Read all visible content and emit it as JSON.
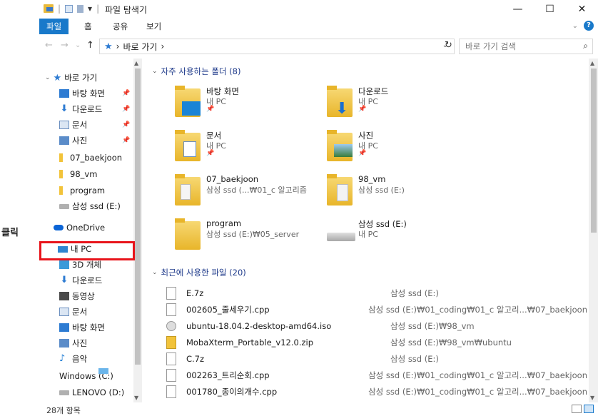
{
  "annotation": {
    "label": "클릭"
  },
  "title_bar": {
    "title": "파일 탐색기",
    "separator": "|",
    "qa_dropdown": "▾"
  },
  "window_controls": {
    "minimize": "—",
    "maximize": "☐",
    "close": "✕"
  },
  "ribbon": {
    "tabs": [
      "파일",
      "홈",
      "공유",
      "보기"
    ],
    "active_tab": "파일",
    "expand_icon": "⌄",
    "help": "?"
  },
  "address_bar": {
    "back": "←",
    "forward": "→",
    "recent": "⌄",
    "up": "↑",
    "path": "바로 가기",
    "separator": "›",
    "dropdown": "⌄",
    "refresh": "↻",
    "search_placeholder": "바로 가기 검색",
    "search_icon": "⌕"
  },
  "nav": {
    "items": [
      {
        "label": "바로 가기",
        "icon": "star-icon",
        "pinned": false
      },
      {
        "label": "바탕 화면",
        "icon": "desktop-icon",
        "pinned": true
      },
      {
        "label": "다운로드",
        "icon": "download-icon",
        "pinned": true
      },
      {
        "label": "문서",
        "icon": "document-icon",
        "pinned": true
      },
      {
        "label": "사진",
        "icon": "picture-icon",
        "pinned": true
      },
      {
        "label": "07_baekjoon",
        "icon": "folder-icon",
        "pinned": false
      },
      {
        "label": "98_vm",
        "icon": "folder-icon",
        "pinned": false
      },
      {
        "label": "program",
        "icon": "folder-icon",
        "pinned": false
      },
      {
        "label": "삼성 ssd (E:)",
        "icon": "drive-icon",
        "pinned": false
      },
      {
        "label": "OneDrive",
        "icon": "cloud-icon",
        "pinned": false
      },
      {
        "label": "내 PC",
        "icon": "pc-icon",
        "pinned": false
      },
      {
        "label": "3D 개체",
        "icon": "cube-icon",
        "pinned": false
      },
      {
        "label": "다운로드",
        "icon": "download-icon",
        "pinned": false
      },
      {
        "label": "동영상",
        "icon": "video-icon",
        "pinned": false
      },
      {
        "label": "문서",
        "icon": "document-icon",
        "pinned": false
      },
      {
        "label": "바탕 화면",
        "icon": "desktop-icon",
        "pinned": false
      },
      {
        "label": "사진",
        "icon": "picture-icon",
        "pinned": false
      },
      {
        "label": "음악",
        "icon": "music-icon",
        "pinned": false
      },
      {
        "label": "Windows (C:)",
        "icon": "windows-drive-icon",
        "pinned": false
      },
      {
        "label": "LENOVO (D:)",
        "icon": "drive-icon",
        "pinned": false
      }
    ],
    "pin_glyph": "📌",
    "expand_glyph": "⌄"
  },
  "frequent": {
    "header": "자주 사용하는 폴더 (8)",
    "items": [
      {
        "name": "바탕 화면",
        "location": "내 PC",
        "pinned": true
      },
      {
        "name": "다운로드",
        "location": "내 PC",
        "pinned": true
      },
      {
        "name": "문서",
        "location": "내 PC",
        "pinned": true
      },
      {
        "name": "사진",
        "location": "내 PC",
        "pinned": true
      },
      {
        "name": "07_baekjoon",
        "location": "삼성 ssd (...₩01_c 알고리즘",
        "pinned": false
      },
      {
        "name": "98_vm",
        "location": "삼성 ssd (E:)",
        "pinned": false
      },
      {
        "name": "program",
        "location": "삼성 ssd (E:)₩05_server",
        "pinned": false
      },
      {
        "name": "삼성 ssd (E:)",
        "location": "내 PC",
        "pinned": false
      }
    ]
  },
  "recent": {
    "header": "최근에 사용한 파일 (20)",
    "files": [
      {
        "name": "E.7z",
        "location": "삼성 ssd (E:)",
        "type": "file"
      },
      {
        "name": "002605_줄세우기.cpp",
        "location": "삼성 ssd (E:)₩01_coding₩01_c 알고리...₩07_baekjoon",
        "type": "file"
      },
      {
        "name": "ubuntu-18.04.2-desktop-amd64.iso",
        "location": "삼성 ssd (E:)₩98_vm",
        "type": "iso"
      },
      {
        "name": "MobaXterm_Portable_v12.0.zip",
        "location": "삼성 ssd (E:)₩98_vm₩ubuntu",
        "type": "zip"
      },
      {
        "name": "C.7z",
        "location": "삼성 ssd (E:)",
        "type": "file"
      },
      {
        "name": "002263_트리순회.cpp",
        "location": "삼성 ssd (E:)₩01_coding₩01_c 알고리...₩07_baekjoon",
        "type": "file"
      },
      {
        "name": "001780_종이의개수.cpp",
        "location": "삼성 ssd (E:)₩01_coding₩01_c 알고리...₩07_baekjoon",
        "type": "file"
      }
    ]
  },
  "scroll": {
    "up": "▲",
    "down": "▼"
  },
  "status": {
    "count": "28개 항목"
  },
  "colors": {
    "accent": "#1979ca",
    "highlight_box": "#e8141b",
    "selected_bg": "#cce8ff"
  }
}
